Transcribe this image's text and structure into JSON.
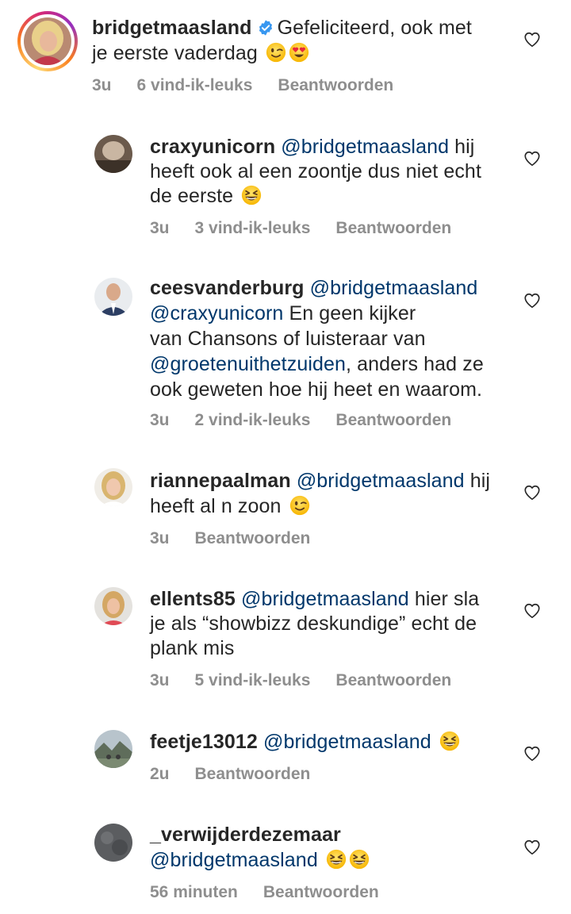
{
  "comments": [
    {
      "username": "bridgetmaasland",
      "verified": true,
      "lines": [
        "Gefeliciteerd, ook met",
        "je eerste vaderdag"
      ],
      "emojis": [
        "winking-face",
        "heart-eyes-face"
      ],
      "time": "3u",
      "likes": "6 vind-ik-leuks",
      "reply": "Beantwoorden"
    },
    {
      "username": "craxyunicorn",
      "mention": "@bridgetmaasland",
      "line1_rest": "hij",
      "lines": [
        "heeft ook al een zoontje dus niet echt",
        "de eerste"
      ],
      "emojis": [
        "grinning-squinting-face"
      ],
      "time": "3u",
      "likes": "3 vind-ik-leuks",
      "reply": "Beantwoorden"
    },
    {
      "username": "ceesvanderburg",
      "mention": "@bridgetmaasland",
      "mention2": "@craxyunicorn",
      "line2_rest": "En geen kijker",
      "line3": "van Chansons of luisteraar van",
      "mention3": "@groetenuithetzuiden",
      "line4_rest": ", anders had ze",
      "line5": "ook geweten hoe hij heet en waarom.",
      "time": "3u",
      "likes": "2 vind-ik-leuks",
      "reply": "Beantwoorden"
    },
    {
      "username": "riannepaalman",
      "mention": "@bridgetmaasland",
      "line1_rest": "hij",
      "line2": "heeft al n zoon",
      "emojis": [
        "winking-face"
      ],
      "time": "3u",
      "reply": "Beantwoorden"
    },
    {
      "username": "ellents85",
      "mention": "@bridgetmaasland",
      "line1_rest": "hier sla",
      "line2": "je als “showbizz deskundige” echt de",
      "line3": "plank mis",
      "time": "3u",
      "likes": "5 vind-ik-leuks",
      "reply": "Beantwoorden"
    },
    {
      "username": "feetje13012",
      "mention": "@bridgetmaasland",
      "emojis": [
        "grinning-squinting-face"
      ],
      "time": "2u",
      "reply": "Beantwoorden"
    },
    {
      "username": "_verwijderdezemaar",
      "mention": "@bridgetmaasland",
      "emojis": [
        "grinning-squinting-face",
        "grinning-squinting-face"
      ],
      "time": "56 minuten",
      "reply": "Beantwoorden"
    }
  ],
  "colors": {
    "text": "#262626",
    "mention": "#00376b",
    "meta": "#8e8e8e",
    "verified": "#3897f0"
  }
}
